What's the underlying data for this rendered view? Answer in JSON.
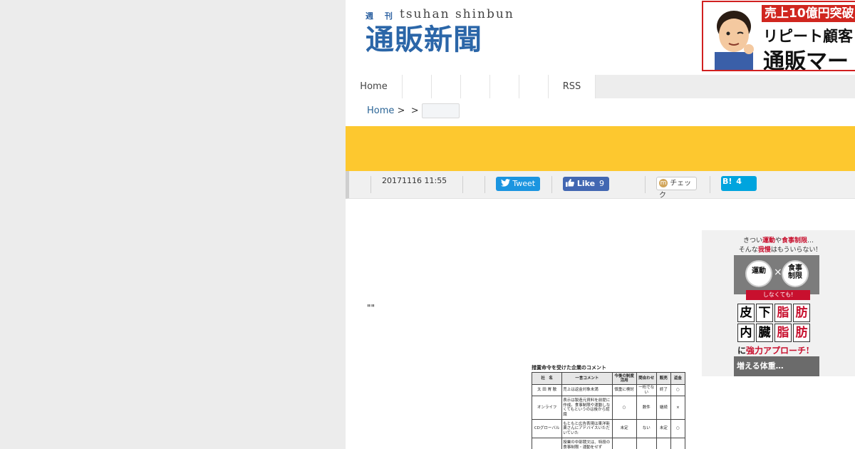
{
  "header": {
    "logo_small": "週 刊",
    "logo_roman": "tsuhan shinbun",
    "logo_main": "通販新聞"
  },
  "top_banner": {
    "line1": "売上10億円突破",
    "line2": "リピート顧客",
    "line3": "通販マー"
  },
  "nav": {
    "items": [
      "Home",
      "",
      "",
      "",
      "",
      "",
      "RSS"
    ]
  },
  "breadcrumb": {
    "home": "Home",
    "sep1": ">",
    "sep2": ">"
  },
  "share": {
    "date": "20171116 11:55",
    "tweet_label": "Tweet",
    "like_label": "Like",
    "like_count": "9",
    "check_label": "チェック",
    "hatena_label": "B!",
    "hatena_count": "4"
  },
  "article": {
    "quote_mark": "\"\""
  },
  "side_ad": {
    "line1_a": "きつい",
    "line1_b": "運動",
    "line1_c": "や",
    "line1_d": "食事制限",
    "line1_e": "…",
    "line2_a": "そんな",
    "line2_b": "我慢",
    "line2_c": "はもういらない!",
    "circle_left": "運動",
    "times": "×",
    "circle_right_1": "食事",
    "circle_right_2": "制限",
    "band": "しなくても!",
    "row1": [
      "皮",
      "下",
      "脂",
      "肪"
    ],
    "row2": [
      "内",
      "臓",
      "脂",
      "肪"
    ],
    "approach_a": "に",
    "approach_b": "強力アプローチ!",
    "bottom": "増える体重…"
  },
  "table_figure": {
    "caption": "措置命令を受けた企業のコメント",
    "headers": [
      "社　名",
      "一言コメント",
      "今後の制度活用",
      "問合わせ",
      "販売",
      "返金"
    ],
    "rows": [
      [
        "太 田 胃 散",
        "売上は返金対象未満",
        "慎重に検討",
        "一桁でない",
        "終了",
        "○"
      ],
      [
        "オンライフ",
        "表示は製造元資料を前提に作成。食事制限や運動しなくてもというのは後から認識",
        "○",
        "数件",
        "継続",
        "×"
      ],
      [
        "CDグローバル",
        "もともと広告表現は東洋新薬さんにアドバイスいただいていた",
        "未定",
        "ない",
        "未定",
        "○"
      ],
      [
        "",
        "授業の中部競文は、特段の食事制限・運動をせず",
        "",
        "",
        "",
        ""
      ]
    ]
  }
}
